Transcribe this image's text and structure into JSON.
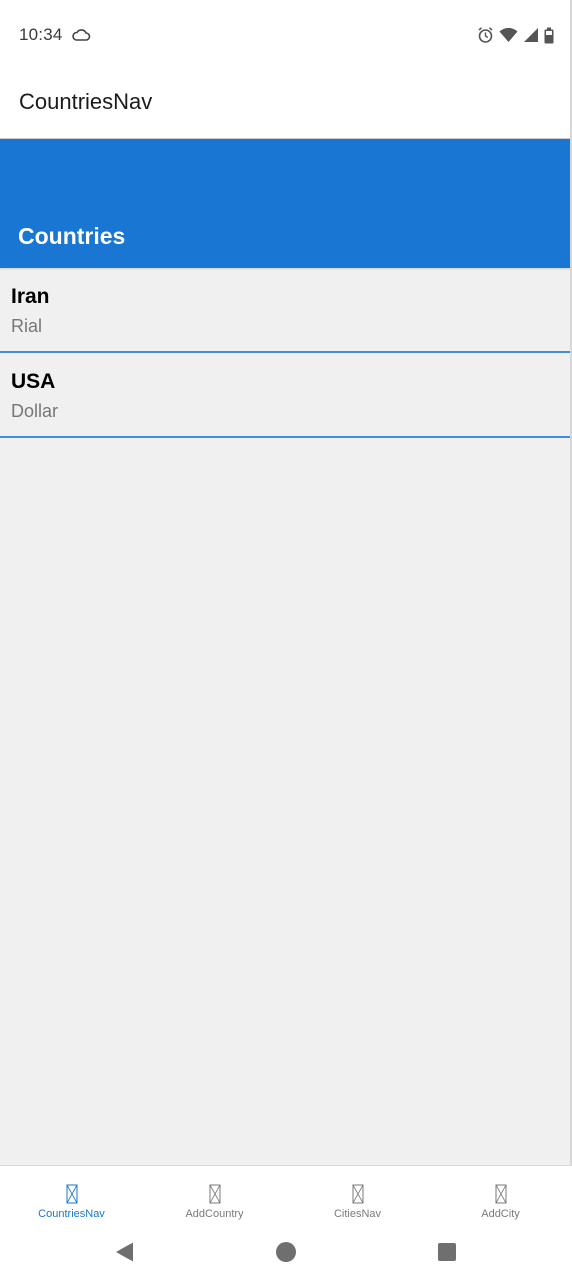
{
  "status_bar": {
    "time": "10:34",
    "icons": [
      "cloud-icon",
      "alarm-icon",
      "wifi-icon",
      "signal-icon",
      "battery-icon"
    ]
  },
  "app_bar": {
    "title": "CountriesNav"
  },
  "header": {
    "title": "Countries"
  },
  "countries": [
    {
      "name": "Iran",
      "currency": "Rial"
    },
    {
      "name": "USA",
      "currency": "Dollar"
    }
  ],
  "bottom_nav": {
    "tabs": [
      {
        "label": "CountriesNav",
        "icon": "placeholder-icon",
        "active": true
      },
      {
        "label": "AddCountry",
        "icon": "placeholder-icon",
        "active": false
      },
      {
        "label": "CitiesNav",
        "icon": "placeholder-icon",
        "active": false
      },
      {
        "label": "AddCity",
        "icon": "placeholder-icon",
        "active": false
      }
    ]
  },
  "colors": {
    "accent": "#1976d2",
    "divider": "#3d8fdb",
    "background": "#f0f0f0"
  }
}
